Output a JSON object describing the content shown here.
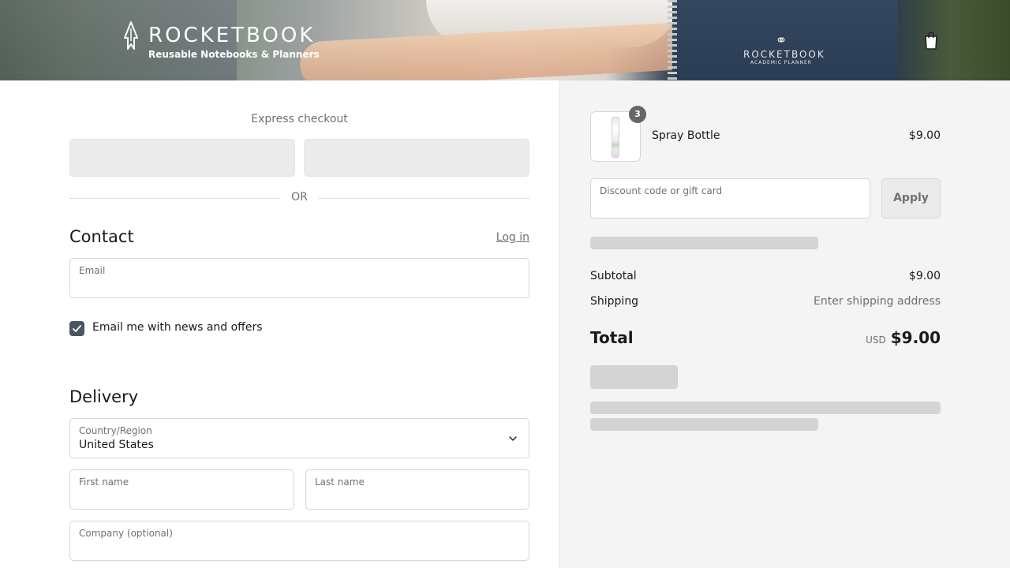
{
  "header": {
    "brand_name": "ROCKETBOOK",
    "brand_tagline": "Reusable Notebooks & Planners",
    "banner_notebook_title": "ROCKETBOOK",
    "banner_notebook_subtitle": "ACADEMIC PLANNER",
    "cart_icon": "shopping-bag-icon"
  },
  "express": {
    "title": "Express checkout",
    "divider_text": "OR"
  },
  "contact": {
    "title": "Contact",
    "login_link": "Log in",
    "email_label": "Email",
    "email_value": "",
    "newsletter_label": "Email me with news and offers",
    "newsletter_checked": true
  },
  "delivery": {
    "title": "Delivery",
    "country_label": "Country/Region",
    "country_value": "United States",
    "first_name_label": "First name",
    "last_name_label": "Last name",
    "company_label": "Company (optional)"
  },
  "order": {
    "items": [
      {
        "name": "Spray Bottle",
        "price": "$9.00",
        "quantity": "3"
      }
    ],
    "discount_placeholder": "Discount code or gift card",
    "apply_label": "Apply",
    "subtotal_label": "Subtotal",
    "subtotal_value": "$9.00",
    "shipping_label": "Shipping",
    "shipping_value": "Enter shipping address",
    "total_label": "Total",
    "total_currency": "USD",
    "total_value": "$9.00"
  },
  "colors": {
    "accent": "#4a5563",
    "panel_bg": "#f4f4f4",
    "muted_text": "#707070",
    "skeleton": "#d4d4d4"
  }
}
